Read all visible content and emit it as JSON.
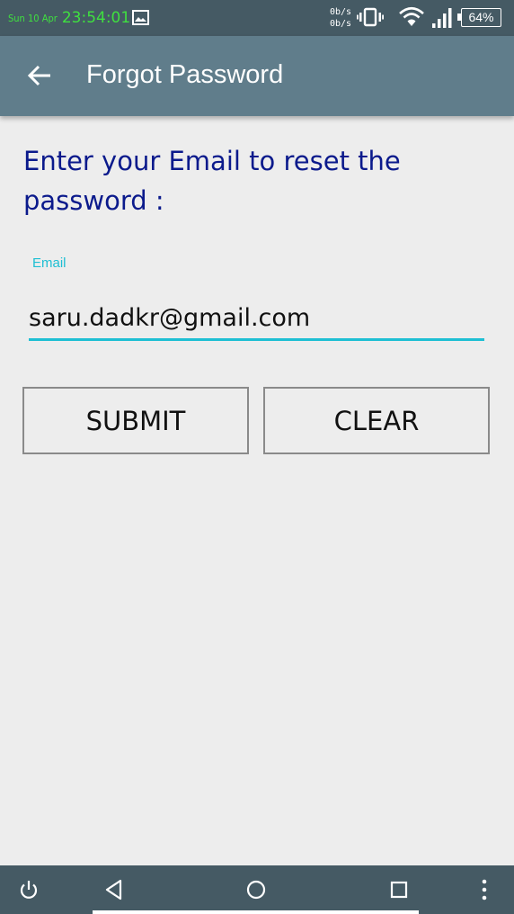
{
  "status_bar": {
    "date": "Sun 10 Apr",
    "time": "23:54:01",
    "net_up": "0b/s",
    "net_down": "0b/s",
    "battery": "64%",
    "icons": [
      "gallery-icon",
      "vibrate-icon",
      "wifi-icon",
      "signal-icon",
      "battery-icon"
    ]
  },
  "app_bar": {
    "title": "Forgot Password",
    "back_icon": "arrow-back-icon"
  },
  "form": {
    "prompt": "Enter your Email to reset the password :",
    "email_label": "Email",
    "email_value": "saru.dadkr@gmail.com"
  },
  "buttons": {
    "submit": "SUBMIT",
    "clear": "CLEAR"
  },
  "nav_bar": {
    "icons": [
      "power-icon",
      "back-triangle-icon",
      "home-circle-icon",
      "recents-square-icon",
      "more-dots-icon"
    ]
  },
  "colors": {
    "status_bar": "#455a64",
    "app_bar": "#607d8b",
    "accent": "#1ebfd3",
    "prompt_text": "#0b1a8c",
    "clock_green": "#3fe03f"
  }
}
